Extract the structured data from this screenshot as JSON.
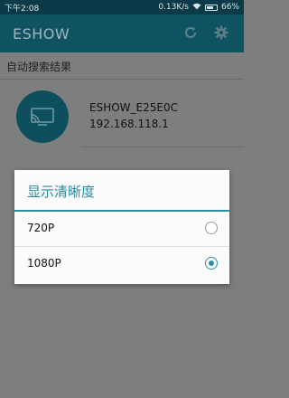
{
  "status_bar": {
    "time": "下午2:08",
    "speed": "0.13K/s",
    "battery": "66%"
  },
  "app_bar": {
    "title": "ESHOW"
  },
  "content": {
    "section_title": "自动搜索结果",
    "device": {
      "name": "ESHOW_E25E0C",
      "ip": "192.168.118.1"
    }
  },
  "dialog": {
    "title": "显示清晰度",
    "options": [
      {
        "label": "720P",
        "selected": false
      },
      {
        "label": "1080P",
        "selected": true
      }
    ]
  },
  "colors": {
    "accent": "#2f8ea6",
    "app_bar": "#0f5262",
    "status_bar": "#0b3a48"
  }
}
